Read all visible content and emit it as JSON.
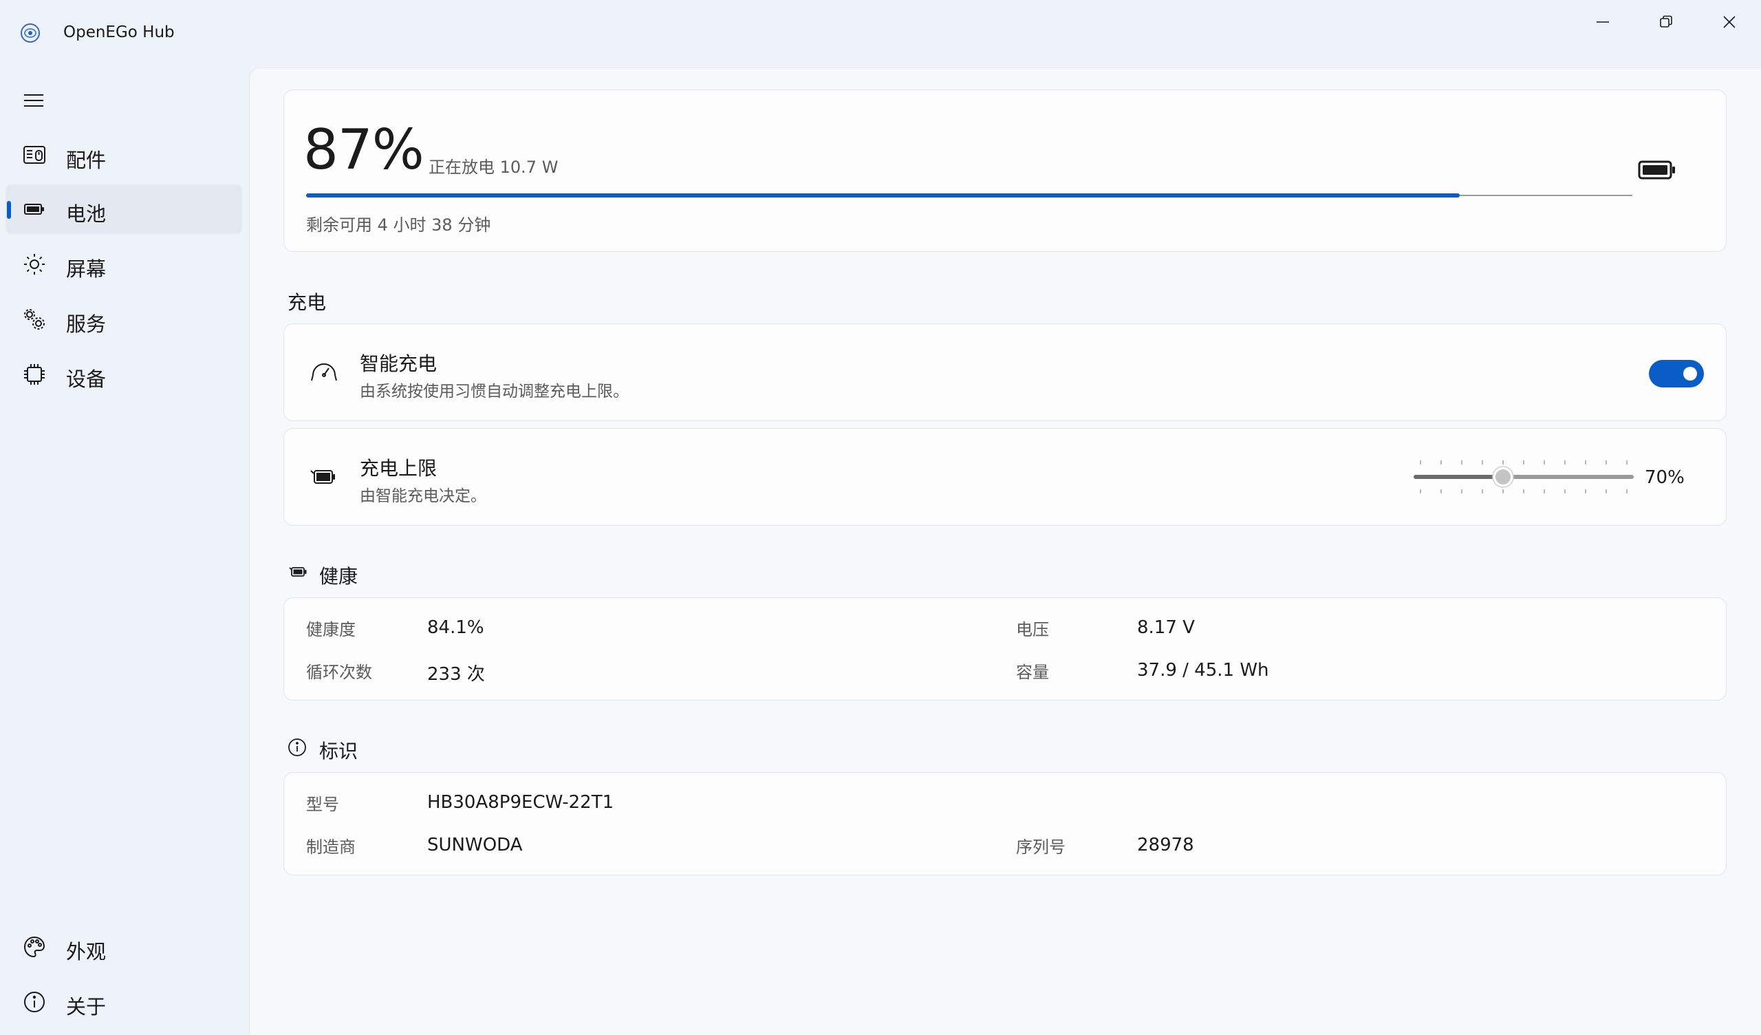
{
  "app": {
    "title": "OpenEGo Hub"
  },
  "nav": {
    "items": [
      {
        "label": "配件",
        "icon": "accessories-icon"
      },
      {
        "label": "电池",
        "icon": "battery-icon",
        "selected": true
      },
      {
        "label": "屏幕",
        "icon": "brightness-icon"
      },
      {
        "label": "服务",
        "icon": "services-gear-icon"
      },
      {
        "label": "设备",
        "icon": "chip-icon"
      }
    ],
    "bottom": [
      {
        "label": "外观",
        "icon": "palette-icon"
      },
      {
        "label": "关于",
        "icon": "info-icon"
      }
    ]
  },
  "battery": {
    "percent_text": "87%",
    "percent": 87,
    "status": "正在放电 10.7 W",
    "remaining": "剩余可用 4 小时 38 分钟"
  },
  "charging": {
    "section_title": "充电",
    "smart": {
      "title": "智能充电",
      "subtitle": "由系统按使用习惯自动调整充电上限。",
      "enabled": true
    },
    "limit": {
      "title": "充电上限",
      "subtitle": "由智能充电决定。",
      "value_text": "70%",
      "value": 70
    }
  },
  "health": {
    "section_title": "健康",
    "rows": [
      {
        "label": "健康度",
        "value": "84.1%"
      },
      {
        "label": "循环次数",
        "value": "233 次"
      },
      {
        "label": "电压",
        "value": "8.17 V"
      },
      {
        "label": "容量",
        "value": "37.9 / 45.1 Wh"
      }
    ]
  },
  "identity": {
    "section_title": "标识",
    "rows": [
      {
        "label": "型号",
        "value": "HB30A8P9ECW-22T1"
      },
      {
        "label": "制造商",
        "value": "SUNWODA"
      },
      {
        "label": "序列号",
        "value": "28978"
      }
    ]
  },
  "colors": {
    "accent": "#0a5cc7",
    "background": "#eef2f9",
    "card": "#fdfdfe"
  }
}
